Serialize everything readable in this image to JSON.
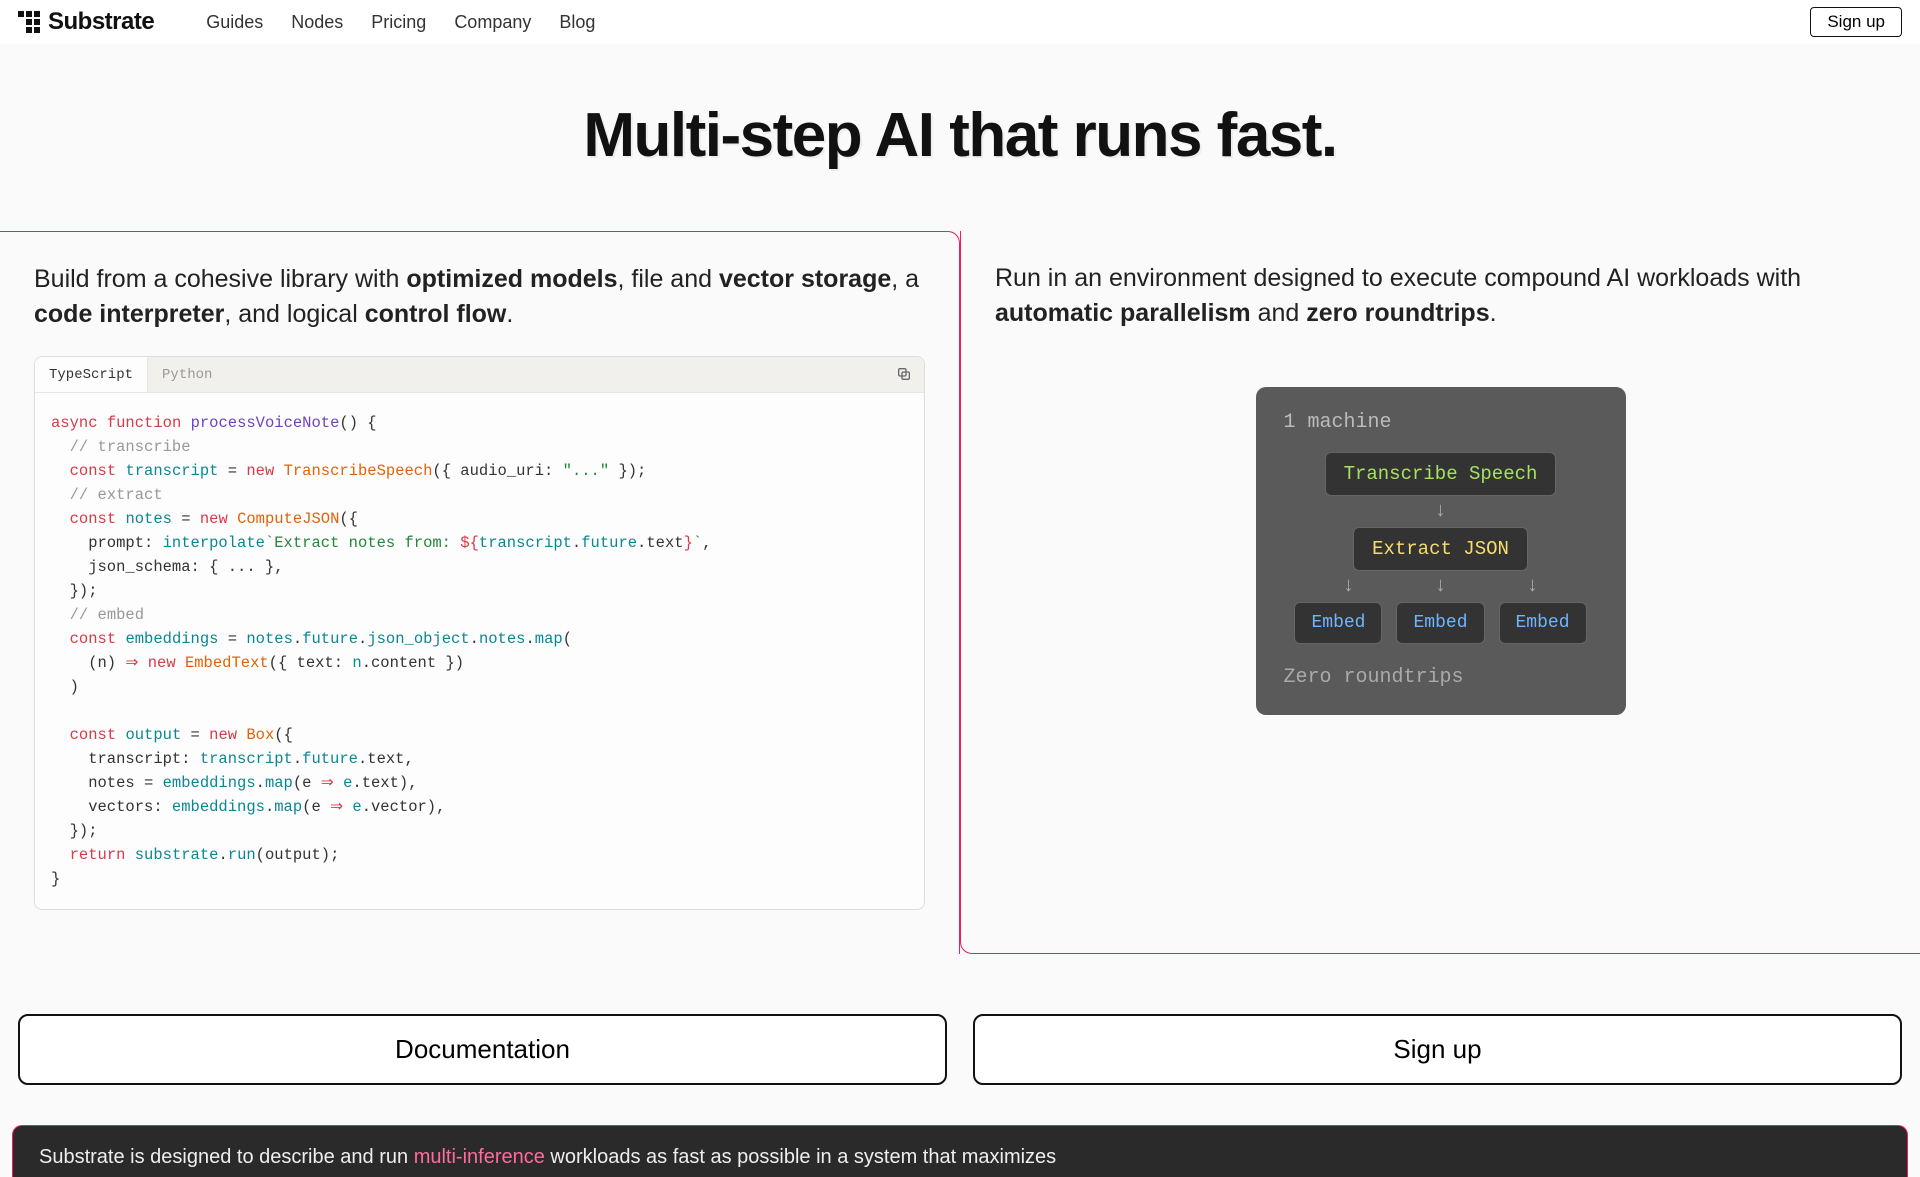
{
  "brand": "Substrate",
  "nav": {
    "items": [
      "Guides",
      "Nodes",
      "Pricing",
      "Company",
      "Blog"
    ],
    "signup": "Sign up"
  },
  "hero": {
    "title": "Multi-step AI that runs fast."
  },
  "left": {
    "text_pre": "Build from a cohesive library with ",
    "b1": "optimized models",
    "mid1": ", file and ",
    "b2": "vector storage",
    "mid2": ", a ",
    "b3": "code interpreter",
    "mid3": ", and logical ",
    "b4": "control flow",
    "end": ".",
    "tabs": {
      "ts": "TypeScript",
      "py": "Python"
    }
  },
  "right": {
    "text_pre": "Run in an environment designed to execute compound AI workloads with ",
    "b1": "automatic parallelism",
    "mid": " and ",
    "b2": "zero roundtrips",
    "end": "."
  },
  "diagram": {
    "title": "1 machine",
    "node1": "Transcribe Speech",
    "node2": "Extract JSON",
    "embed": "Embed",
    "footer": "Zero roundtrips"
  },
  "cta": {
    "docs": "Documentation",
    "signup": "Sign up"
  },
  "strip": {
    "pre": "Substrate is designed to describe and run ",
    "hl": "multi-inference",
    "post": " workloads as fast as possible in a system that maximizes"
  }
}
